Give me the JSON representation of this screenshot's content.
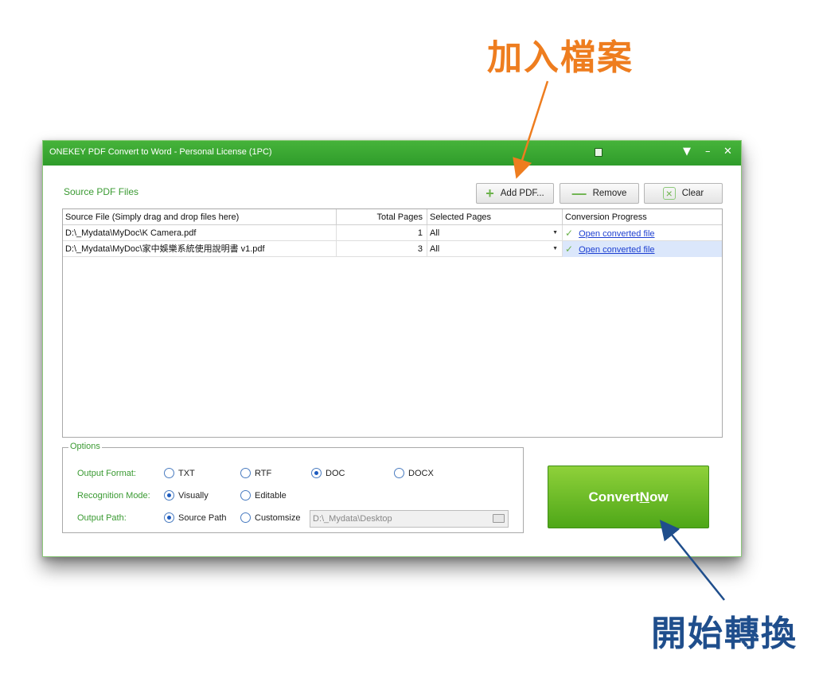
{
  "annotations": {
    "top": "加入檔案",
    "bottom": "開始轉換",
    "top_color": "#ee7d1f",
    "bottom_color": "#1f4e8c"
  },
  "window": {
    "title": "ONEKEY PDF Convert to Word - Personal License (1PC)",
    "accent": "#3aa534",
    "icons": [
      "doc-icon",
      "menu-icon",
      "minimize-icon",
      "close-icon"
    ]
  },
  "toolbar": {
    "section_label": "Source PDF Files",
    "add_label": "Add PDF...",
    "remove_label": "Remove",
    "clear_label": "Clear"
  },
  "table": {
    "headers": {
      "source": "Source File (Simply drag and drop files here)",
      "total": "Total Pages",
      "selected": "Selected Pages",
      "progress": "Conversion Progress"
    },
    "rows": [
      {
        "source": "D:\\_Mydata\\MyDoc\\K Camera.pdf",
        "total": "1",
        "selected": "All",
        "progress": "Open converted file"
      },
      {
        "source": "D:\\_Mydata\\MyDoc\\家中娛樂系統使用說明書 v1.pdf",
        "total": "3",
        "selected": "All",
        "progress": "Open converted file"
      }
    ]
  },
  "options": {
    "legend": "Options",
    "output_format_label": "Output Format:",
    "formats": [
      "TXT",
      "RTF",
      "DOC",
      "DOCX"
    ],
    "selected_format": "DOC",
    "recognition_label": "Recognition Mode:",
    "recognition_modes": [
      "Visually",
      "Editable"
    ],
    "selected_recognition": "Visually",
    "path_label": "Output Path:",
    "path_modes": [
      "Source Path",
      "Customsize"
    ],
    "selected_path_mode": "Source Path",
    "path_value": "D:\\_Mydata\\Desktop"
  },
  "convert": {
    "label_pre": "Convert ",
    "label_ul": "N",
    "label_post": "ow"
  }
}
